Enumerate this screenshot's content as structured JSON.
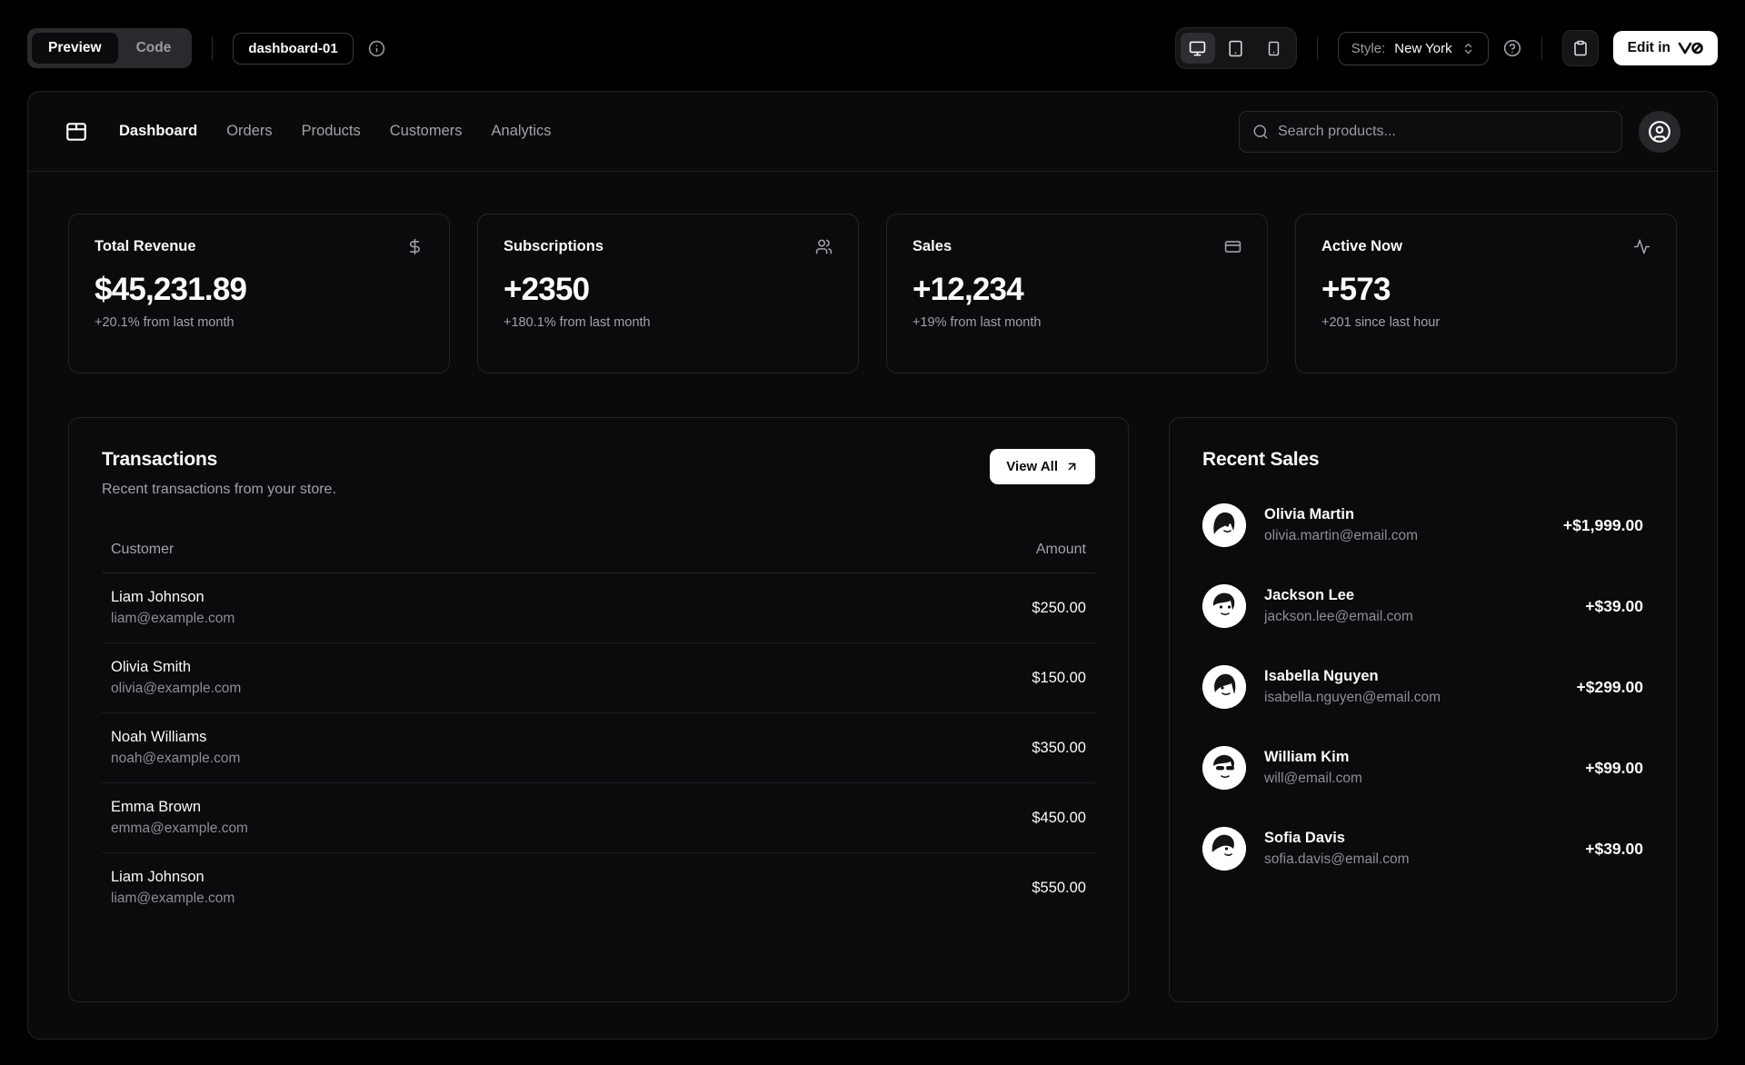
{
  "toolbar": {
    "view_toggle": {
      "preview": "Preview",
      "code": "Code"
    },
    "block_name": "dashboard-01",
    "style_label": "Style:",
    "style_value": "New York",
    "edit_label": "Edit in"
  },
  "nav": {
    "items": [
      {
        "label": "Dashboard"
      },
      {
        "label": "Orders"
      },
      {
        "label": "Products"
      },
      {
        "label": "Customers"
      },
      {
        "label": "Analytics"
      }
    ],
    "search_placeholder": "Search products..."
  },
  "stats": [
    {
      "title": "Total Revenue",
      "icon": "dollar-sign-icon",
      "value": "$45,231.89",
      "change": "+20.1% from last month"
    },
    {
      "title": "Subscriptions",
      "icon": "users-icon",
      "value": "+2350",
      "change": "+180.1% from last month"
    },
    {
      "title": "Sales",
      "icon": "credit-card-icon",
      "value": "+12,234",
      "change": "+19% from last month"
    },
    {
      "title": "Active Now",
      "icon": "activity-icon",
      "value": "+573",
      "change": "+201 since last hour"
    }
  ],
  "transactions": {
    "title": "Transactions",
    "subtitle": "Recent transactions from your store.",
    "view_all_label": "View All",
    "columns": {
      "customer": "Customer",
      "amount": "Amount"
    },
    "rows": [
      {
        "name": "Liam Johnson",
        "email": "liam@example.com",
        "amount": "$250.00"
      },
      {
        "name": "Olivia Smith",
        "email": "olivia@example.com",
        "amount": "$150.00"
      },
      {
        "name": "Noah Williams",
        "email": "noah@example.com",
        "amount": "$350.00"
      },
      {
        "name": "Emma Brown",
        "email": "emma@example.com",
        "amount": "$450.00"
      },
      {
        "name": "Liam Johnson",
        "email": "liam@example.com",
        "amount": "$550.00"
      }
    ]
  },
  "recent_sales": {
    "title": "Recent Sales",
    "items": [
      {
        "name": "Olivia Martin",
        "email": "olivia.martin@email.com",
        "amount": "+$1,999.00"
      },
      {
        "name": "Jackson Lee",
        "email": "jackson.lee@email.com",
        "amount": "+$39.00"
      },
      {
        "name": "Isabella Nguyen",
        "email": "isabella.nguyen@email.com",
        "amount": "+$299.00"
      },
      {
        "name": "William Kim",
        "email": "will@email.com",
        "amount": "+$99.00"
      },
      {
        "name": "Sofia Davis",
        "email": "sofia.davis@email.com",
        "amount": "+$39.00"
      }
    ]
  },
  "colors": {
    "background": "#000000",
    "panel": "#0a0a0b",
    "card_border": "#232327",
    "muted_text": "#a1a1aa",
    "foreground": "#fafafa",
    "accent_button": "#ffffff"
  }
}
